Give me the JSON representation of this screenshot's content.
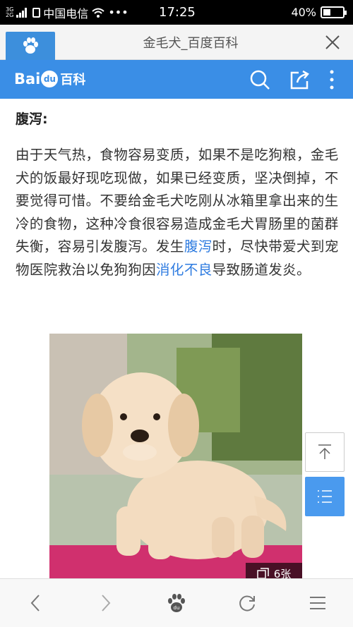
{
  "status": {
    "network_top": "3G",
    "network_bottom": "2G",
    "carrier": "中国电信",
    "more": "•••",
    "time": "17:25",
    "battery": "40%",
    "battery_level": 0.4
  },
  "tab": {
    "title": "金毛犬_百度百科"
  },
  "header": {
    "logo_bai": "Bai",
    "logo_du": "du",
    "logo_baike": "百科"
  },
  "article": {
    "section_title": "腹泻:",
    "para_1": "由于天气热，食物容易变质，如果不是吃狗粮，金毛犬的饭最好现吃现做，如果已经变质，坚决倒掉，不要觉得可惜。不要给金毛犬吃刚从冰箱里拿出来的生冷的食物，这种冷食很容易造成金毛犬胃肠里的菌群失衡，容易引发腹泻。发生",
    "link_1": "腹泻",
    "para_2": "时，尽快带爱犬到宠物医院救治以免狗狗因",
    "link_2": "消化不良",
    "para_3": "导致肠道发炎。",
    "photo_count": "6张"
  },
  "colors": {
    "accent": "#3a8ee6",
    "link": "#2f7ce0"
  },
  "icons": {
    "search": "search-icon",
    "share": "share-icon",
    "menu": "more-vertical-icon",
    "back": "chevron-left-icon",
    "forward": "chevron-right-icon",
    "home": "baidu-paw-icon",
    "refresh": "refresh-icon",
    "bottom_menu": "hamburger-icon"
  }
}
